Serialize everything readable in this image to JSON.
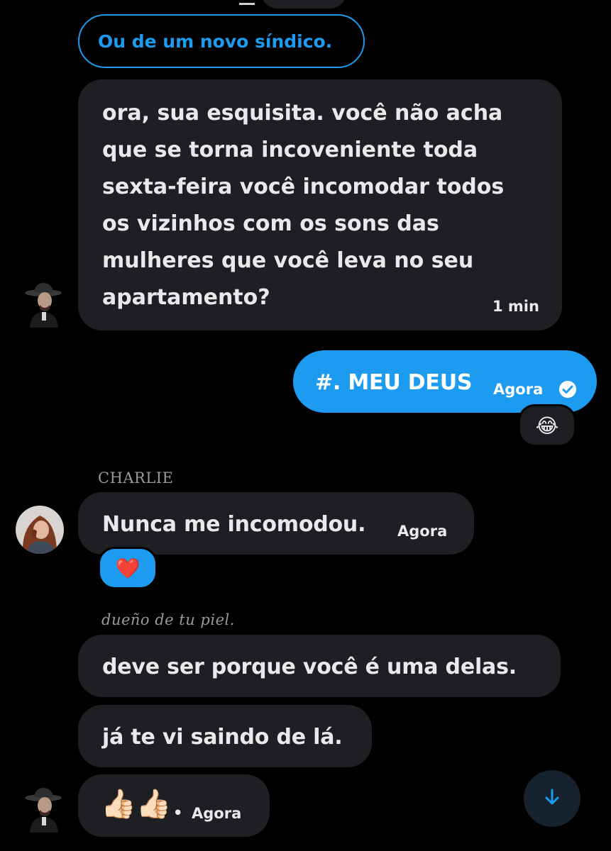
{
  "colors": {
    "accent": "#1d9bf0",
    "bubble_incoming": "#1e1f22",
    "background": "#000000"
  },
  "quoted_reply": {
    "text": "Ou de um novo síndico."
  },
  "messages": [
    {
      "direction": "incoming",
      "lines": [
        "ora, sua esquisita. você não acha",
        "que se torna incoveniente toda",
        "sexta-feira você incomodar todos",
        "os vizinhos com os sons das",
        "mulheres que você leva no seu",
        "apartamento?"
      ],
      "time": "1 min",
      "avatar": "man-in-hat-avatar"
    },
    {
      "direction": "outgoing",
      "text": "#. MEU DEUS",
      "time": "Agora",
      "status_icon": "check-circle-icon",
      "reaction": "😂"
    },
    {
      "direction": "incoming",
      "sender": "CHARLIE",
      "text": "Nunca me incomodou.",
      "time": "Agora",
      "avatar": "woman-avatar",
      "reaction": "❤️"
    },
    {
      "direction": "incoming",
      "sender": "dueño de tu piel.",
      "text": "deve ser porque você é uma delas."
    },
    {
      "direction": "incoming",
      "text": "já te vi saindo de lá."
    },
    {
      "direction": "incoming",
      "text": "👍🏻👍🏻",
      "separator": "•",
      "time": "Agora",
      "avatar": "man-in-hat-avatar"
    }
  ],
  "scroll_button": {
    "icon": "arrow-down-icon"
  }
}
